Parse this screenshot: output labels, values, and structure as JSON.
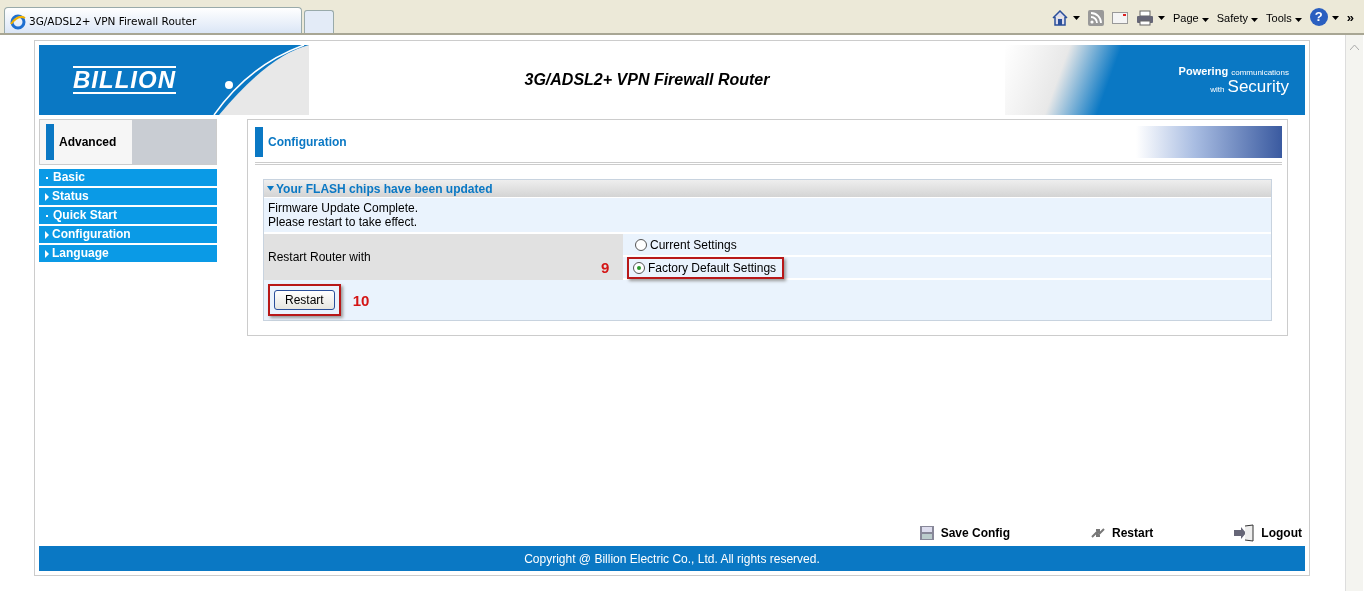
{
  "browser": {
    "tab_title": "3G/ADSL2+ VPN Firewall Router",
    "toolbar": [
      "Page",
      "Safety",
      "Tools"
    ],
    "help_glyph": "?",
    "overflow_glyph": "»"
  },
  "header": {
    "logo": "BILLION",
    "title": "3G/ADSL2+ VPN Firewall Router",
    "slogan_big": "Powering",
    "slogan_small": "communications",
    "slogan_with": "with",
    "slogan_security": "Security"
  },
  "sidebar": {
    "heading": "Advanced",
    "items": [
      {
        "label": "Basic",
        "kind": "dot"
      },
      {
        "label": "Status",
        "kind": "arrow"
      },
      {
        "label": "Quick Start",
        "kind": "dot"
      },
      {
        "label": "Configuration",
        "kind": "arrow"
      },
      {
        "label": "Language",
        "kind": "arrow"
      }
    ]
  },
  "panel": {
    "title": "Configuration",
    "section_title": "Your FLASH chips have been updated",
    "message_lines": [
      "Firmware Update Complete.",
      "Please restart to take effect."
    ],
    "restart_label": "Restart Router with",
    "options": [
      {
        "label": "Current Settings",
        "selected": false
      },
      {
        "label": "Factory Default Settings",
        "selected": true
      }
    ],
    "button": "Restart",
    "annotations": [
      {
        "label": "9"
      },
      {
        "label": "10"
      }
    ]
  },
  "footer_actions": [
    {
      "label": "Save Config",
      "kind": "save"
    },
    {
      "label": "Restart",
      "kind": "restart"
    },
    {
      "label": "Logout",
      "kind": "logout"
    }
  ],
  "copyright": "Copyright @ Billion Electric Co., Ltd. All rights reserved."
}
